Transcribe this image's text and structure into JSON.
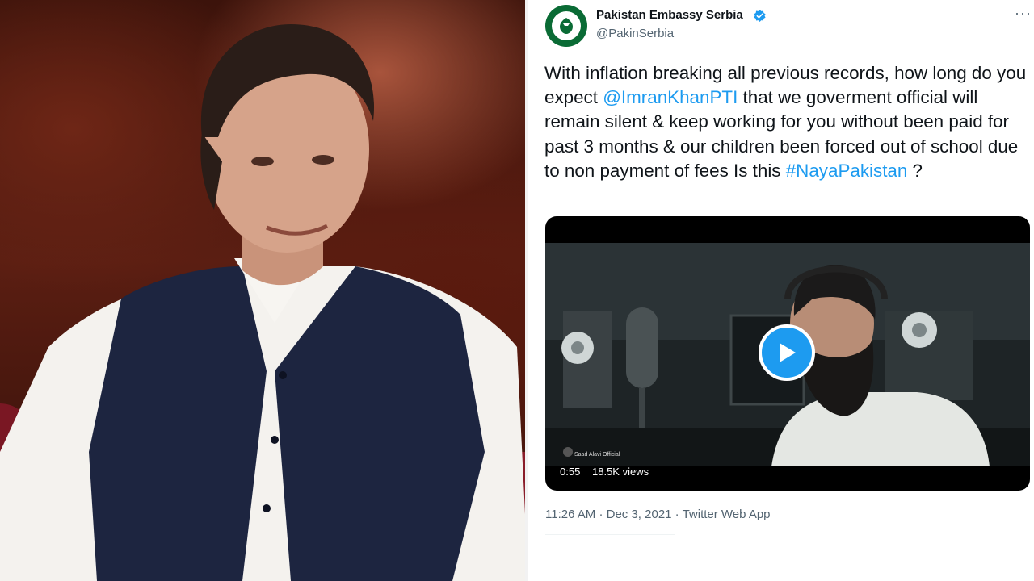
{
  "photo": {
    "description_icon": "portrait-photo"
  },
  "tweet": {
    "account": {
      "name": "Pakistan Embassy Serbia",
      "handle": "@PakinSerbia",
      "verified_icon": "verified-badge-icon",
      "avatar_icon": "government-emblem-icon"
    },
    "more_icon": "more-options-icon",
    "more_label": "···",
    "text": {
      "part1": "With inflation breaking all previous records, how long do you expect ",
      "mention": "@ImranKhanPTI",
      "part2": " that we goverment official will remain silent & keep working for you without been paid for past 3 months & our children been forced out of school due to non payment of fees Is this ",
      "hashtag": "#NayaPakistan",
      "part3": "  ?"
    },
    "video": {
      "duration": "0:55",
      "views": "18.5K views",
      "watermark": "Saad Alavi Official",
      "play_icon": "play-icon"
    },
    "meta": {
      "time": "11:26 AM",
      "date": "Dec 3, 2021",
      "source": "Twitter Web App",
      "separator": "·"
    }
  },
  "colors": {
    "accent": "#1d9bf0",
    "text_primary": "#0f1419",
    "text_secondary": "#536471",
    "avatar_green": "#0a6b35"
  }
}
